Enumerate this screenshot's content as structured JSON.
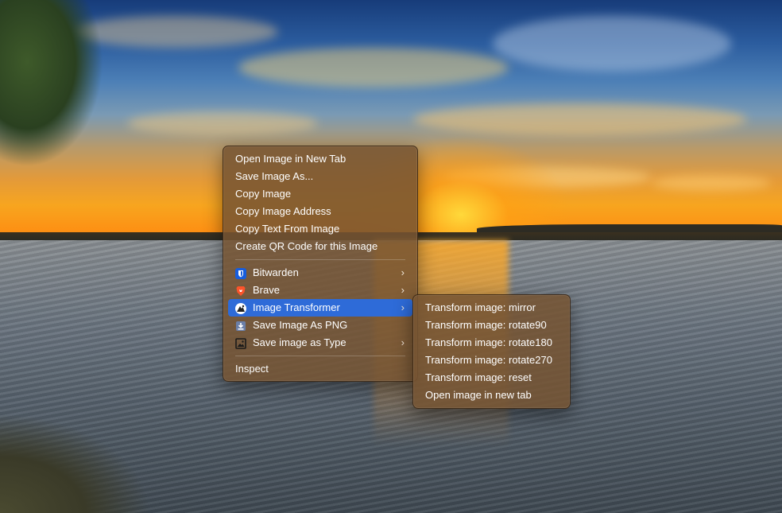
{
  "context_menu": {
    "items": [
      {
        "label": "Open Image in New Tab"
      },
      {
        "label": "Save Image As..."
      },
      {
        "label": "Copy Image"
      },
      {
        "label": "Copy Image Address"
      },
      {
        "label": "Copy Text From Image"
      },
      {
        "label": "Create QR Code for this Image"
      }
    ],
    "extensions": [
      {
        "label": "Bitwarden",
        "icon": "bitwarden-shield-icon",
        "has_submenu": true
      },
      {
        "label": "Brave",
        "icon": "brave-lion-icon",
        "has_submenu": true
      },
      {
        "label": "Image Transformer",
        "icon": "image-transformer-icon",
        "has_submenu": true,
        "highlighted": true
      },
      {
        "label": "Save Image As PNG",
        "icon": "save-png-icon",
        "has_submenu": false
      },
      {
        "label": "Save image as Type",
        "icon": "image-type-icon",
        "has_submenu": true
      }
    ],
    "inspect_label": "Inspect",
    "chevron": "›"
  },
  "submenu": {
    "items": [
      {
        "label": "Transform image: mirror"
      },
      {
        "label": "Transform image: rotate90"
      },
      {
        "label": "Transform image: rotate180"
      },
      {
        "label": "Transform image: rotate270"
      },
      {
        "label": "Transform image: reset"
      },
      {
        "label": "Open image in new tab"
      }
    ]
  },
  "colors": {
    "highlight": "#2e6bd8",
    "menu_background": "#765432",
    "bitwarden_blue": "#175ddc",
    "brave_orange": "#fb542b"
  }
}
